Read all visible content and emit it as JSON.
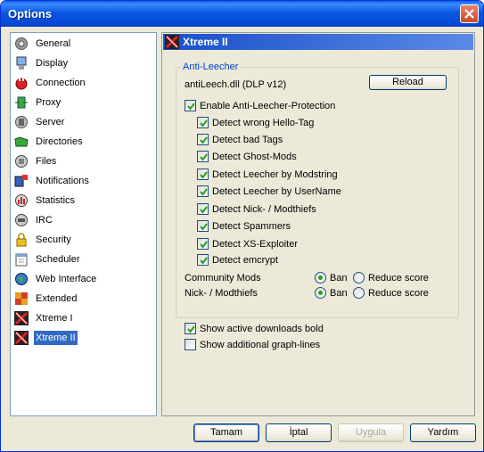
{
  "window": {
    "title": "Options"
  },
  "nav": {
    "items": [
      {
        "label": "General",
        "icon": "gear-icon"
      },
      {
        "label": "Display",
        "icon": "display-icon"
      },
      {
        "label": "Connection",
        "icon": "plug-icon"
      },
      {
        "label": "Proxy",
        "icon": "proxy-icon"
      },
      {
        "label": "Server",
        "icon": "server-icon"
      },
      {
        "label": "Directories",
        "icon": "folder-icon"
      },
      {
        "label": "Files",
        "icon": "files-icon"
      },
      {
        "label": "Notifications",
        "icon": "notifications-icon"
      },
      {
        "label": "Statistics",
        "icon": "statistics-icon"
      },
      {
        "label": "IRC",
        "icon": "irc-icon"
      },
      {
        "label": "Security",
        "icon": "lock-icon"
      },
      {
        "label": "Scheduler",
        "icon": "calendar-icon"
      },
      {
        "label": "Web Interface",
        "icon": "globe-icon"
      },
      {
        "label": "Extended",
        "icon": "puzzle-icon"
      },
      {
        "label": "Xtreme I",
        "icon": "xtreme-icon"
      },
      {
        "label": "Xtreme II",
        "icon": "xtreme-icon"
      }
    ],
    "selected": "Xtreme II"
  },
  "panel": {
    "title": "Xtreme II",
    "group_title": "Anti-Leecher",
    "dll_text": "antiLeech.dll (DLP v12)",
    "reload_label": "Reload",
    "enable_label": "Enable Anti-Leecher-Protection",
    "detect_options": [
      "Detect wrong Hello-Tag",
      "Detect bad Tags",
      "Detect Ghost-Mods",
      "Detect Leecher by Modstring",
      "Detect Leecher by UserName",
      "Detect Nick- / Modthiefs",
      "Detect Spammers",
      "Detect XS-Exploiter",
      "Detect emcrypt"
    ],
    "community_mods_label": "Community Mods",
    "nick_modthiefs_label": "Nick- / Modthiefs",
    "ban_label": "Ban",
    "reduce_label": "Reduce score",
    "community_selected": "Ban",
    "nick_selected": "Ban",
    "show_active_label": "Show active downloads bold",
    "show_active_checked": true,
    "show_graph_label": "Show additional graph-lines",
    "show_graph_checked": false
  },
  "buttons": {
    "ok": "Tamam",
    "cancel": "İptal",
    "apply": "Uygula",
    "help": "Yardım"
  },
  "colors": {
    "title_bar": "#0a58e0",
    "selection": "#316ac5",
    "group_title": "#0046d5"
  }
}
